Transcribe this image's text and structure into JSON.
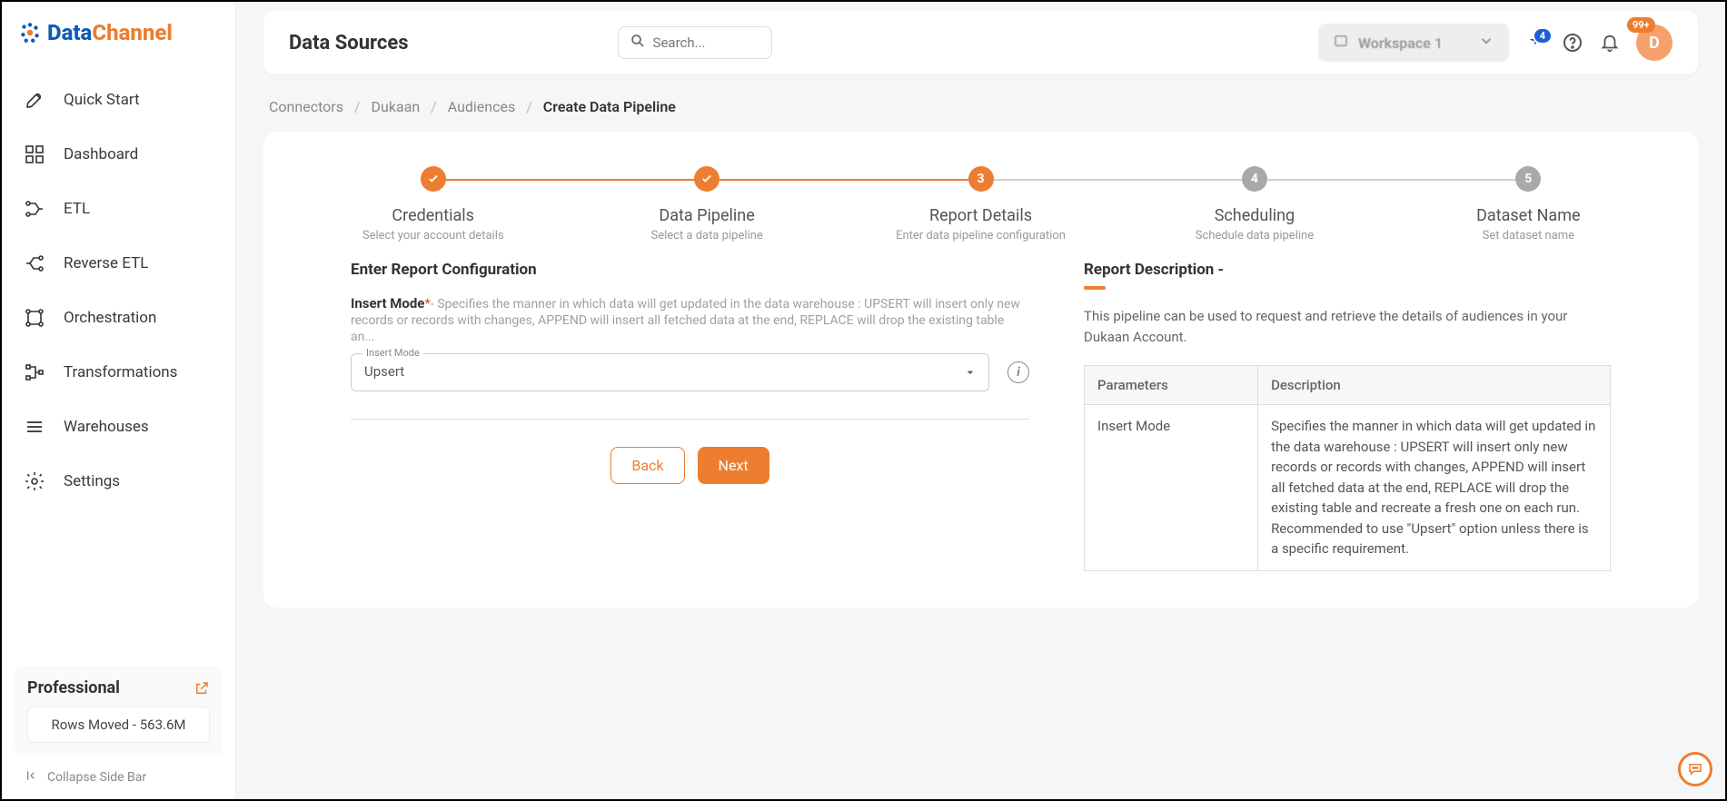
{
  "brand": {
    "first": "Data",
    "second": "Channel"
  },
  "sidebar": {
    "items": [
      {
        "label": "Quick Start",
        "icon": "rocket"
      },
      {
        "label": "Dashboard",
        "icon": "dashboard"
      },
      {
        "label": "ETL",
        "icon": "etl"
      },
      {
        "label": "Reverse ETL",
        "icon": "reverse-etl"
      },
      {
        "label": "Orchestration",
        "icon": "orchestration"
      },
      {
        "label": "Transformations",
        "icon": "transform"
      },
      {
        "label": "Warehouses",
        "icon": "warehouse"
      },
      {
        "label": "Settings",
        "icon": "gear"
      }
    ],
    "plan": {
      "name": "Professional",
      "rows_moved_label": "Rows Moved - 563.6M"
    },
    "collapse_label": "Collapse Side Bar"
  },
  "topbar": {
    "title": "Data Sources",
    "search_placeholder": "Search...",
    "workspace_label": "Workspace 1",
    "sparkle_badge": "4",
    "bell_badge": "99+",
    "avatar_initial": "D"
  },
  "breadcrumb": [
    {
      "label": "Connectors",
      "current": false
    },
    {
      "label": "Dukaan",
      "current": false
    },
    {
      "label": "Audiences",
      "current": false
    },
    {
      "label": "Create Data Pipeline",
      "current": true
    }
  ],
  "stepper": [
    {
      "state": "done",
      "badge": "✓",
      "title": "Credentials",
      "sub": "Select your account details"
    },
    {
      "state": "done",
      "badge": "✓",
      "title": "Data Pipeline",
      "sub": "Select a data pipeline"
    },
    {
      "state": "active",
      "badge": "3",
      "title": "Report Details",
      "sub": "Enter data pipeline configuration"
    },
    {
      "state": "pending",
      "badge": "4",
      "title": "Scheduling",
      "sub": "Schedule data pipeline"
    },
    {
      "state": "pending",
      "badge": "5",
      "title": "Dataset Name",
      "sub": "Set dataset name"
    }
  ],
  "report_config": {
    "heading": "Enter Report Configuration",
    "insert_mode_label": "Insert Mode",
    "insert_mode_help": "- Specifies the manner in which data will get updated in the data warehouse : UPSERT will insert only new records or records with changes, APPEND will insert all fetched data at the end, REPLACE will drop the existing table an...",
    "select_float": "Insert Mode",
    "select_value": "Upsert",
    "back_label": "Back",
    "next_label": "Next"
  },
  "report_description": {
    "heading": "Report Description -",
    "text": "This pipeline can be used to request and retrieve the details of audiences in your Dukaan Account.",
    "th_param": "Parameters",
    "th_desc": "Description",
    "row_param": "Insert Mode",
    "row_desc": "Specifies the manner in which data will get updated in the data warehouse : UPSERT will insert only new records or records with changes, APPEND will insert all fetched data at the end, REPLACE will drop the existing table and recreate a fresh one on each run. Recommended to use \"Upsert\" option unless there is a specific requirement."
  }
}
